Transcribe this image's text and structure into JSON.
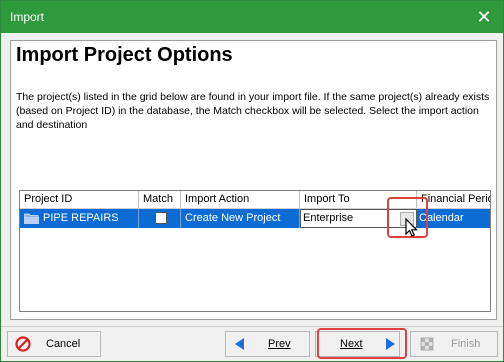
{
  "window": {
    "title": "Import",
    "close_symbol": "✕"
  },
  "page": {
    "heading": "Import Project Options",
    "description": "The project(s) listed in the grid below are found in your import file. If the same project(s) already exists (based on Project ID) in the database, the Match checkbox will be selected.  Select the import action and destination"
  },
  "grid": {
    "columns": [
      "Project ID",
      "Match",
      "Import Action",
      "Import To",
      "Financial Perio"
    ],
    "rows": [
      {
        "project_id": "PIPE REPAIRS",
        "match": false,
        "import_action": "Create New Project",
        "import_to": "Enterprise",
        "financial_period": "Calendar"
      }
    ]
  },
  "buttons": {
    "cancel": "Cancel",
    "prev": "Prev",
    "next": "Next",
    "finish": "Finish"
  },
  "colors": {
    "titlebar": "#2e9a3c",
    "selection": "#0c6cd4",
    "highlight": "#e04040"
  }
}
